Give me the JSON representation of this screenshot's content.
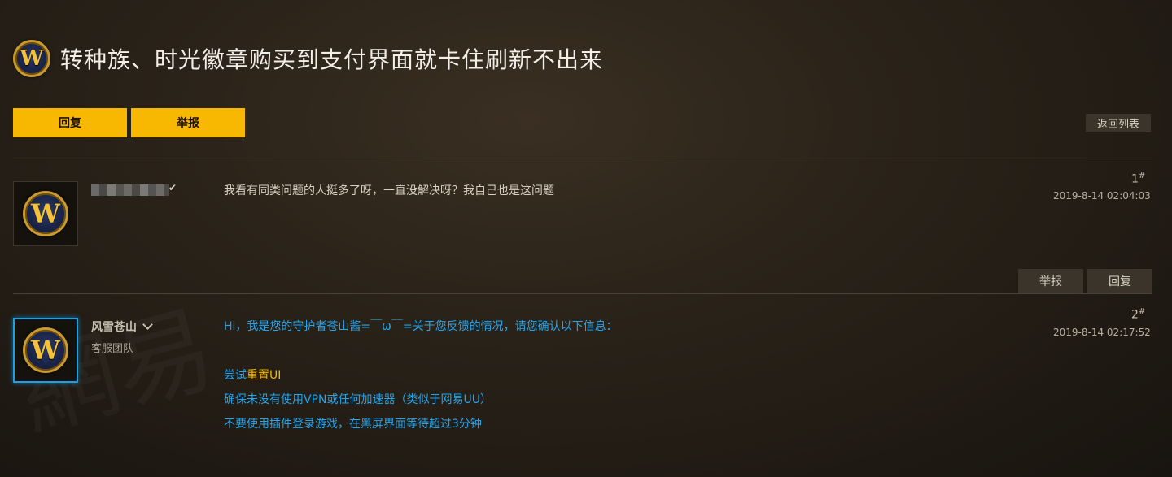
{
  "page": {
    "title": "转种族、时光徽章购买到支付界面就卡住刷新不出来",
    "logo_icon": "wow-logo-icon",
    "logo_letter": "W"
  },
  "toolbar": {
    "reply_label": "回复",
    "report_label": "举报",
    "back_label": "返回列表"
  },
  "watermark": "網易",
  "posts": [
    {
      "floor": "1",
      "floor_mark": "#",
      "date": "2019-8-14 02:04:03",
      "content": "我看有同类问题的人挺多了呀，一直没解决呀？我自己也是这问题",
      "check_icon": "✔",
      "actions": {
        "report": "举报",
        "reply": "回复"
      }
    },
    {
      "floor": "2",
      "floor_mark": "#",
      "date": "2019-8-14 02:17:52",
      "author": "风雪苍山",
      "team": "客服团队",
      "intro": "Hi，我是您的守护者苍山酱=￣ω￣=关于您反馈的情况，请您确认以下信息：",
      "line1_prefix": "尝试",
      "line1_link": "重置UI",
      "line2": "确保未没有使用VPN或任何加速器（类似于网易UU）",
      "line3": "不要使用插件登录游戏，在黑屏界面等待超过3分钟"
    }
  ]
}
